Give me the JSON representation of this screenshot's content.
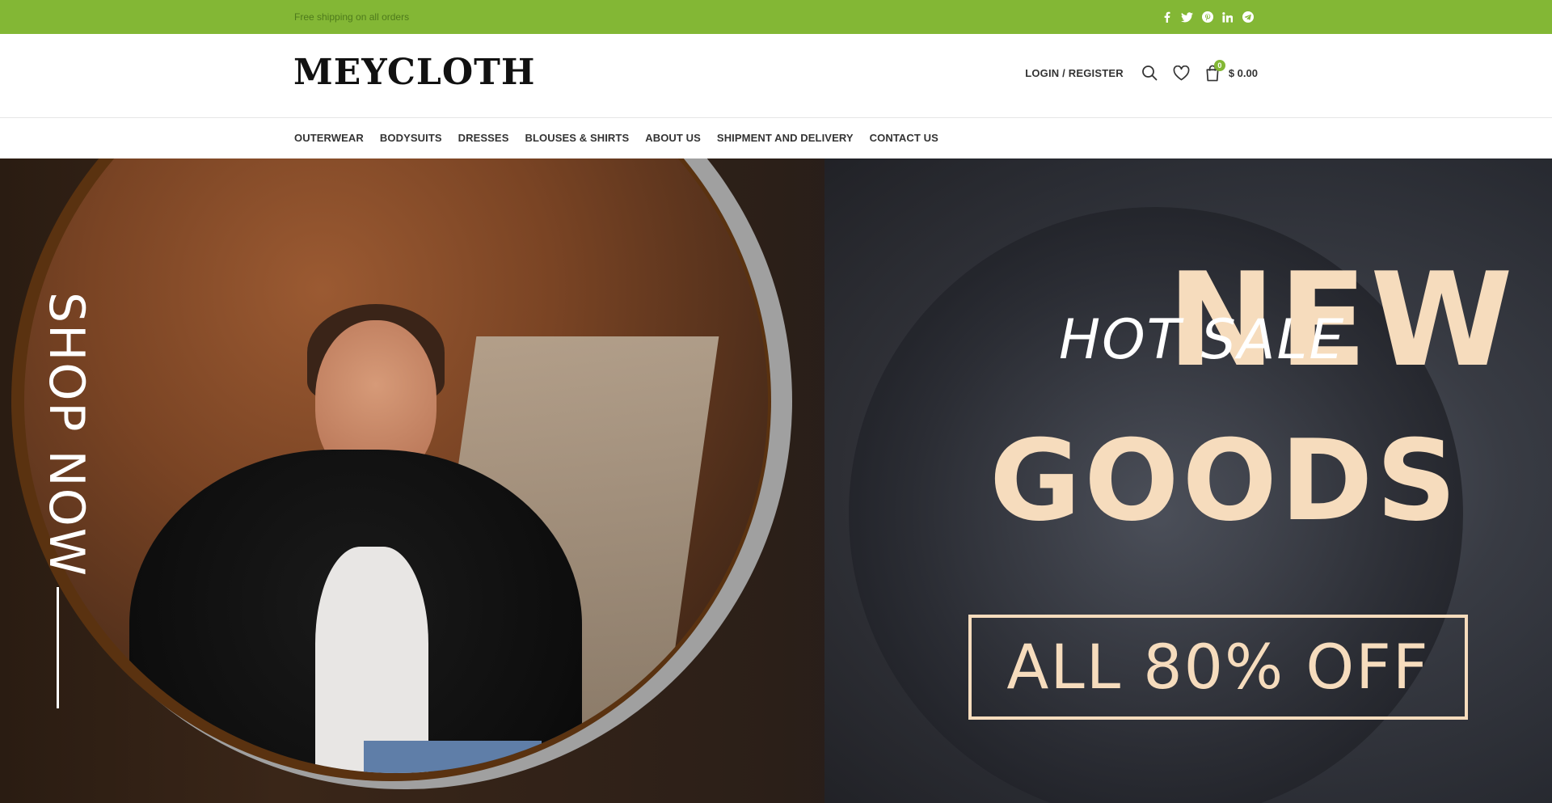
{
  "topbar": {
    "promo": "Free shipping on all orders",
    "socials": [
      "facebook-icon",
      "twitter-icon",
      "pinterest-icon",
      "linkedin-icon",
      "telegram-icon"
    ]
  },
  "header": {
    "logo": "MEYCLOTH",
    "login": "LOGIN / REGISTER",
    "cart_count": "0",
    "cart_amount": "$ 0.00"
  },
  "nav": {
    "items": [
      "OUTERWEAR",
      "BODYSUITS",
      "DRESSES",
      "BLOUSES & SHIRTS",
      "ABOUT US",
      "SHIPMENT AND DELIVERY",
      "CONTACT US"
    ]
  },
  "hero": {
    "shop_now": "SHOP NOW",
    "hot_sale": "HOT SALE",
    "headline_1": "NEW",
    "headline_2": "GOODS",
    "offer": "ALL 80% OFF"
  },
  "colors": {
    "accent": "#83b735",
    "hero_text": "#f6dcbd"
  }
}
